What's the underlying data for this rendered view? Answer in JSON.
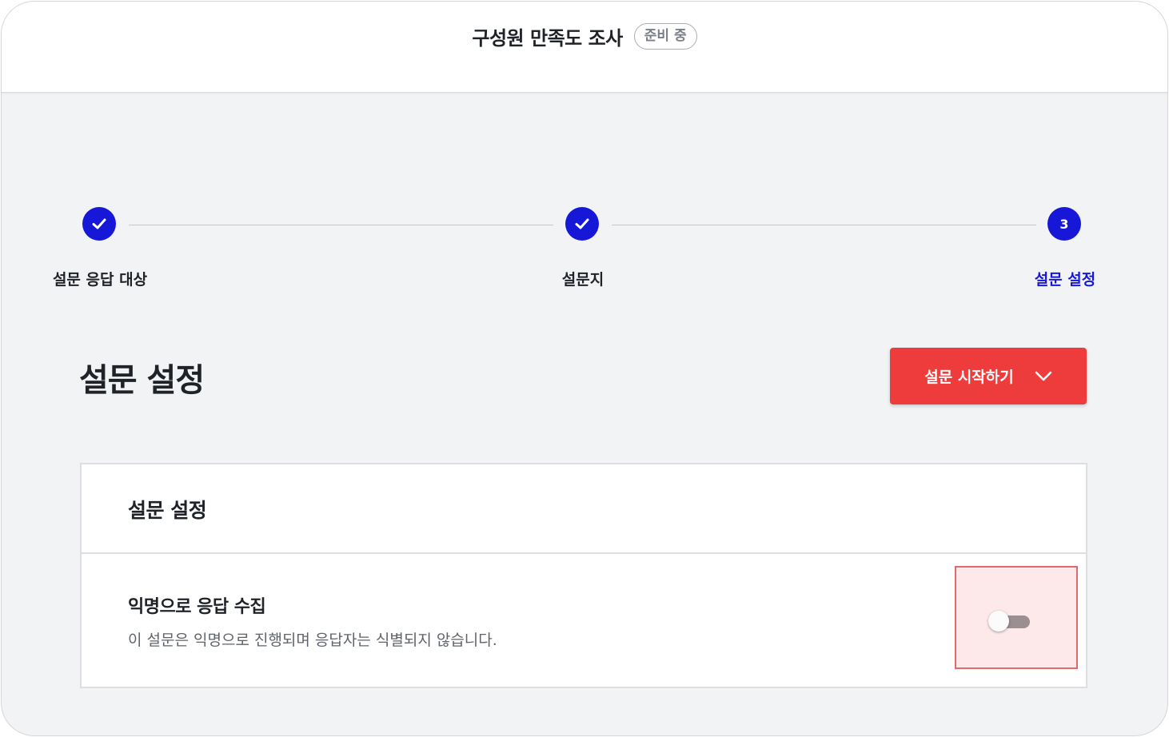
{
  "header": {
    "title": "구성원 만족도 조사",
    "status_badge": "준비 중"
  },
  "stepper": {
    "steps": [
      {
        "label": "설문 응답 대상",
        "state": "completed",
        "icon": "check-icon"
      },
      {
        "label": "설문지",
        "state": "completed",
        "icon": "check-icon"
      },
      {
        "label": "설문 설정",
        "state": "active",
        "number": "3"
      }
    ],
    "active_color": "#1717d8"
  },
  "main": {
    "title": "설문 설정",
    "start_button": {
      "label": "설문 시작하기",
      "icon": "chevron-down-icon",
      "color": "#ee3b3b"
    }
  },
  "panel": {
    "title": "설문 설정",
    "settings": [
      {
        "title": "익명으로 응답 수집",
        "description": "이 설문은 익명으로 진행되며 응답자는 식별되지 않습니다.",
        "toggle_on": false
      }
    ]
  }
}
